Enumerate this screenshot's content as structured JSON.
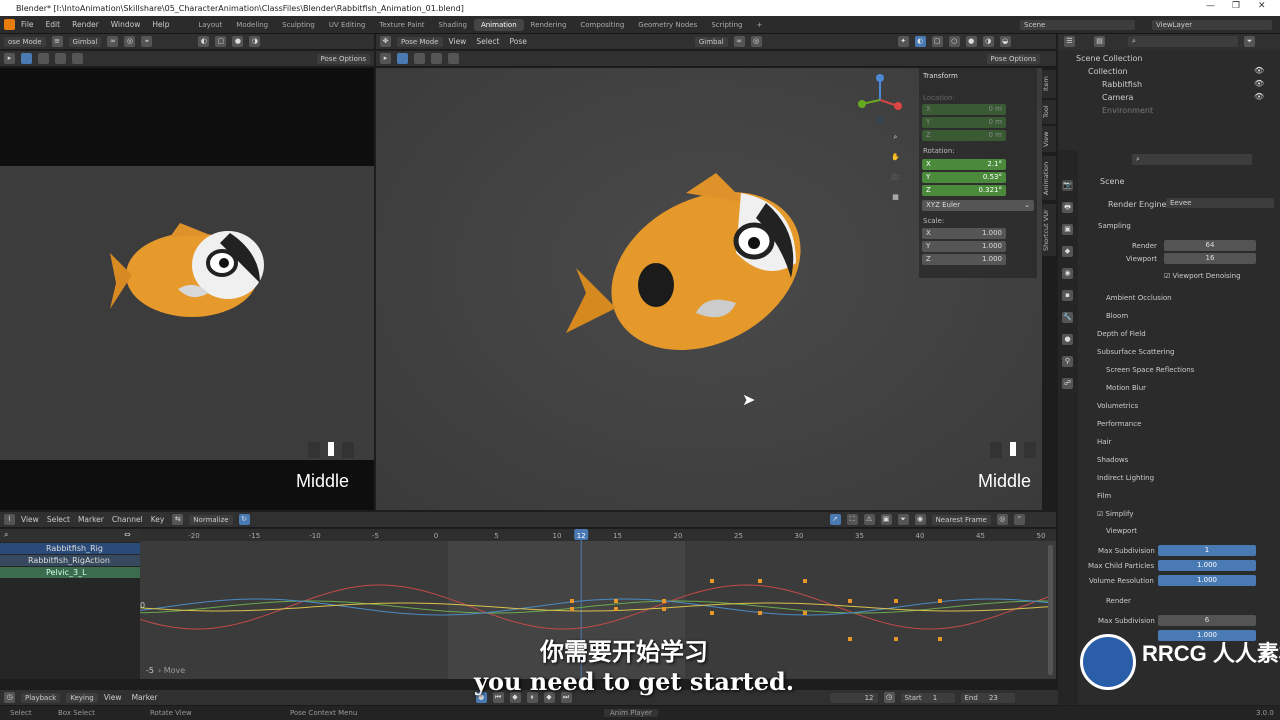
{
  "titlebar": {
    "title": "Blender* [I:\\IntoAnimation\\Skillshare\\05_CharacterAnimation\\ClassFiles\\Blender\\Rabbitfish_Animation_01.blend]"
  },
  "topbar": {
    "menus": [
      "File",
      "Edit",
      "Render",
      "Window",
      "Help"
    ],
    "workspaces": [
      "Layout",
      "Modeling",
      "Sculpting",
      "UV Editing",
      "Texture Paint",
      "Shading",
      "Animation",
      "Rendering",
      "Compositing",
      "Geometry Nodes",
      "Scripting"
    ],
    "scene": "Scene",
    "view_layer": "ViewLayer"
  },
  "left_viewport": {
    "mode": "ose Mode",
    "orientation": "Gimbal",
    "pose_options": "Pose Options",
    "label": "Middle"
  },
  "main_viewport": {
    "mode": "Pose Mode",
    "menus": [
      "View",
      "Select",
      "Pose"
    ],
    "orientation": "Gimbal",
    "pose_options": "Pose Options",
    "label": "Middle"
  },
  "npanel": {
    "title": "Transform",
    "location": "Location:",
    "loc": [
      "0 m",
      "0 m",
      "0 m"
    ],
    "rotation": "Rotation:",
    "rot": [
      "2.1°",
      "0.53°",
      "0.321°"
    ],
    "mode": "XYZ Euler",
    "scale": "Scale:",
    "scl": [
      "1.000",
      "1.000",
      "1.000"
    ],
    "axes": [
      "X",
      "Y",
      "Z"
    ],
    "tabs": [
      "Item",
      "Tool",
      "View",
      "Animation",
      "Shortcut VUr"
    ]
  },
  "outliner": {
    "root": "Scene Collection",
    "collection": "Collection",
    "items": [
      "Rabbitfish",
      "Camera",
      "Environment"
    ]
  },
  "properties": {
    "scene": "Scene",
    "render_engine_label": "Render Engine",
    "render_engine": "Eevee",
    "sampling": "Sampling",
    "render_label": "Render",
    "render_val": "64",
    "viewport_label": "Viewport",
    "viewport_val": "16",
    "denoise": "Viewport Denoising",
    "sections": [
      "Ambient Occlusion",
      "Bloom",
      "Depth of Field",
      "Subsurface Scattering",
      "Screen Space Reflections",
      "Motion Blur",
      "Volumetrics",
      "Performance",
      "Hair",
      "Shadows",
      "Indirect Lighting",
      "Film"
    ],
    "simplify": "Simplify",
    "viewport_sub": "Viewport",
    "max_subdiv": "Max Subdivision",
    "max_subdiv_val": "1",
    "max_child": "Max Child Particles",
    "max_child_val": "1.000",
    "vol_res": "Volume Resolution",
    "vol_res_val": "1.000",
    "render_sub": "Render",
    "r_max_subdiv_val": "6",
    "r_max_child_val": "1.000"
  },
  "graph": {
    "menus": [
      "View",
      "Select",
      "Marker",
      "Channel",
      "Key"
    ],
    "normalize": "Normalize",
    "interp": "Nearest Frame",
    "channels": [
      "Rabbitfish_Rig",
      "Rabbitfish_RigAction",
      "Pelvic_3_L"
    ],
    "frames": [
      "-20",
      "-15",
      "-10",
      "-5",
      "0",
      "5",
      "10",
      "12",
      "15",
      "20",
      "25",
      "30",
      "35",
      "40",
      "45",
      "50"
    ],
    "current": "12",
    "yzero": "0",
    "yneg": "-5",
    "move": "Move"
  },
  "timeline": {
    "menus": [
      "Playback",
      "Keying",
      "View",
      "Marker"
    ],
    "frame": "12",
    "start_label": "Start",
    "start": "1",
    "end_label": "End",
    "end": "23"
  },
  "statusbar": {
    "items": [
      "Select",
      "Box Select",
      "Rotate View",
      "Pose Context Menu",
      "Anim Player"
    ],
    "version": "3.0.0"
  },
  "subtitle": {
    "cn": "你需要开始学习",
    "en": "you need to get started."
  },
  "watermark": "RRCG 人人素材"
}
